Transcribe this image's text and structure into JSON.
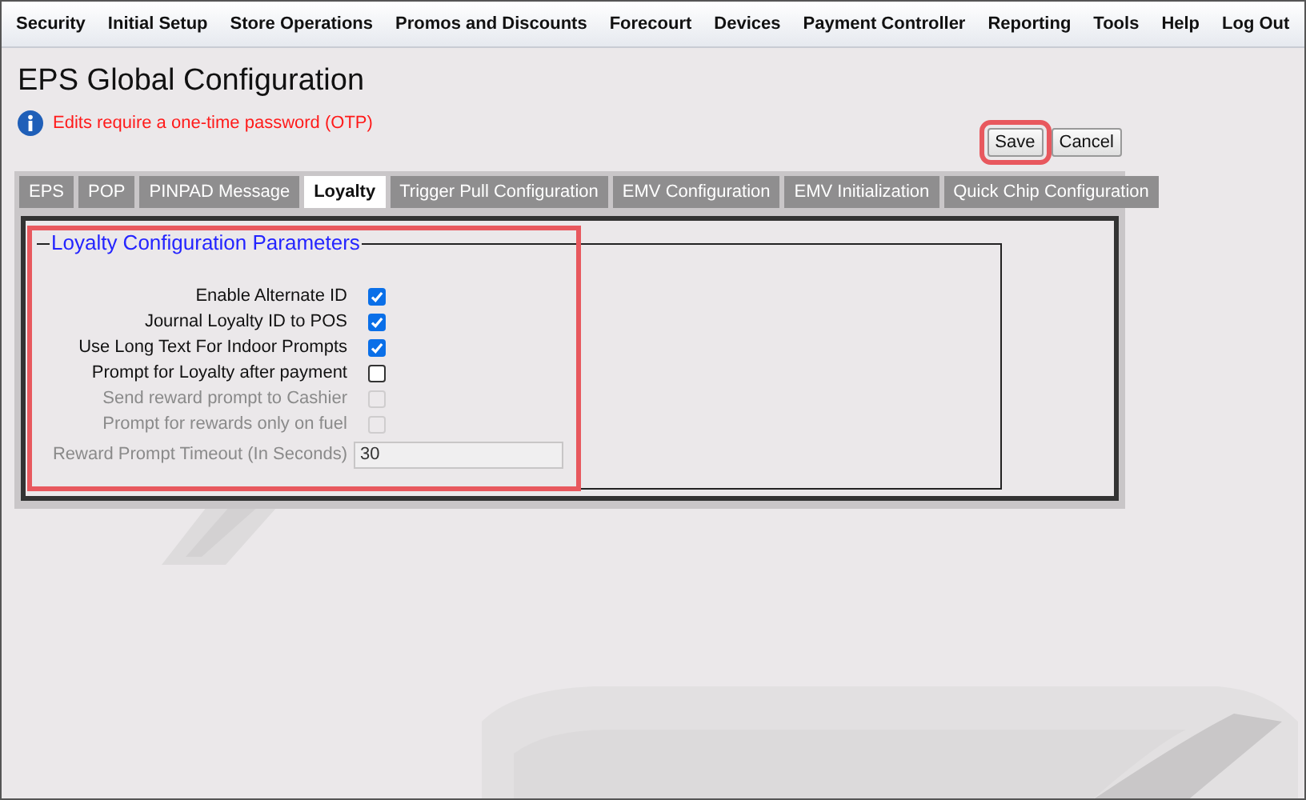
{
  "menu": [
    {
      "label": "Security"
    },
    {
      "label": "Initial Setup"
    },
    {
      "label": "Store Operations"
    },
    {
      "label": "Promos and Discounts"
    },
    {
      "label": "Forecourt"
    },
    {
      "label": "Devices"
    },
    {
      "label": "Payment Controller"
    },
    {
      "label": "Reporting"
    },
    {
      "label": "Tools"
    },
    {
      "label": "Help"
    },
    {
      "label": "Log Out"
    }
  ],
  "page_title": "EPS Global Configuration",
  "notice": "Edits require a one-time password (OTP)",
  "buttons": [
    {
      "label": "Save",
      "highlighted": true
    },
    {
      "label": "Cancel",
      "highlighted": false
    }
  ],
  "tabs": [
    {
      "label": "EPS",
      "selected": false
    },
    {
      "label": "POP",
      "selected": false
    },
    {
      "label": "PINPAD Message",
      "selected": false
    },
    {
      "label": "Loyalty",
      "selected": true
    },
    {
      "label": "Trigger Pull Configuration",
      "selected": false
    },
    {
      "label": "EMV Configuration",
      "selected": false
    },
    {
      "label": "EMV Initialization",
      "selected": false
    },
    {
      "label": "Quick Chip Configuration",
      "selected": false
    }
  ],
  "fieldset": {
    "legend": "Loyalty Configuration Parameters",
    "highlighted": true,
    "fields": [
      {
        "kind": "checkbox",
        "label": "Enable Alternate ID",
        "checked": true,
        "disabled": false
      },
      {
        "kind": "checkbox",
        "label": "Journal Loyalty ID to POS",
        "checked": true,
        "disabled": false
      },
      {
        "kind": "checkbox",
        "label": "Use Long Text For Indoor Prompts",
        "checked": true,
        "disabled": false
      },
      {
        "kind": "checkbox",
        "label": "Prompt for Loyalty after payment",
        "checked": false,
        "disabled": false
      },
      {
        "kind": "checkbox",
        "label": "Send reward prompt to Cashier",
        "checked": false,
        "disabled": true
      },
      {
        "kind": "checkbox",
        "label": "Prompt for rewards only on fuel",
        "checked": false,
        "disabled": true
      },
      {
        "kind": "text",
        "label": "Reward Prompt Timeout (In Seconds)",
        "value": "30",
        "disabled": true
      }
    ]
  }
}
